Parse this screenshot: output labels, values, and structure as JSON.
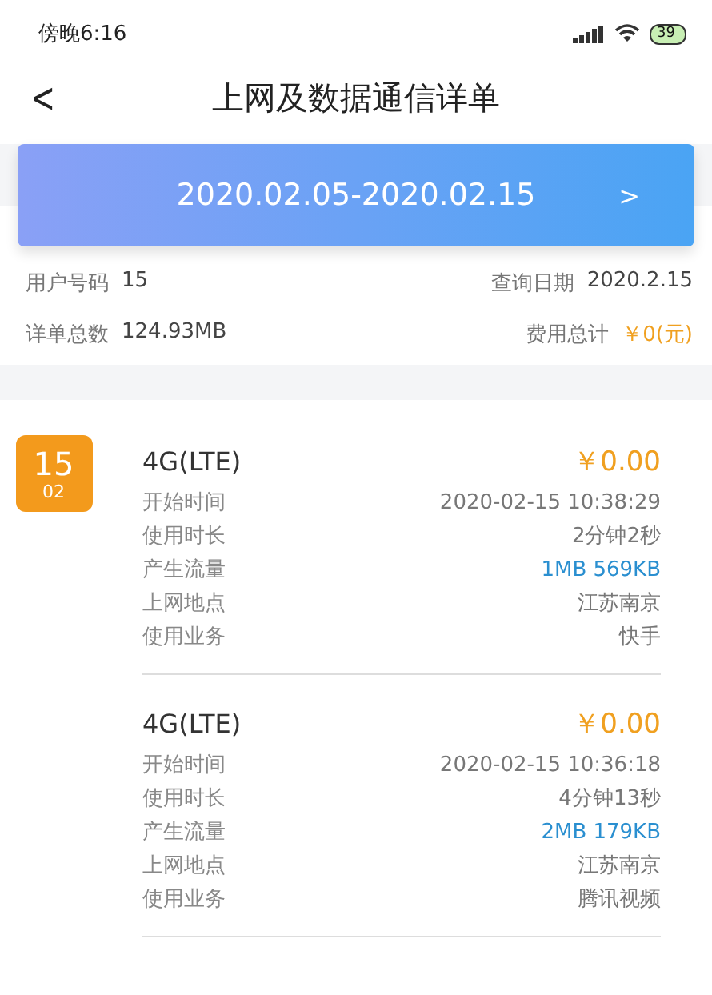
{
  "status_bar": {
    "time": "傍晚6:16",
    "battery": "39"
  },
  "header": {
    "back": "<",
    "title": "上网及数据通信详单"
  },
  "date_range": {
    "label": "2020.02.05-2020.02.15",
    "arrow": ">"
  },
  "summary": [
    {
      "label": "用户号码",
      "value": "15",
      "kind": "plain"
    },
    {
      "label": "查询日期",
      "value": "2020.2.15",
      "kind": "plain"
    },
    {
      "label": "详单总数",
      "value": "124.93MB",
      "kind": "plain"
    },
    {
      "label": "费用总计",
      "value": "￥0(元)",
      "kind": "fee"
    }
  ],
  "day": {
    "day": "15",
    "month": "02"
  },
  "records": [
    {
      "network": "4G(LTE)",
      "fee": "￥0.00",
      "fields": [
        {
          "label": "开始时间",
          "value": "2020-02-15 10:38:29",
          "kind": "plain"
        },
        {
          "label": "使用时长",
          "value": "2分钟2秒",
          "kind": "plain"
        },
        {
          "label": "产生流量",
          "value": "1MB 569KB",
          "kind": "traffic"
        },
        {
          "label": "上网地点",
          "value": "江苏南京",
          "kind": "plain"
        },
        {
          "label": "使用业务",
          "value": "快手",
          "kind": "plain"
        }
      ]
    },
    {
      "network": "4G(LTE)",
      "fee": "￥0.00",
      "fields": [
        {
          "label": "开始时间",
          "value": "2020-02-15 10:36:18",
          "kind": "plain"
        },
        {
          "label": "使用时长",
          "value": "4分钟13秒",
          "kind": "plain"
        },
        {
          "label": "产生流量",
          "value": "2MB 179KB",
          "kind": "traffic"
        },
        {
          "label": "上网地点",
          "value": "江苏南京",
          "kind": "plain"
        },
        {
          "label": "使用业务",
          "value": "腾讯视频",
          "kind": "plain"
        }
      ]
    }
  ]
}
